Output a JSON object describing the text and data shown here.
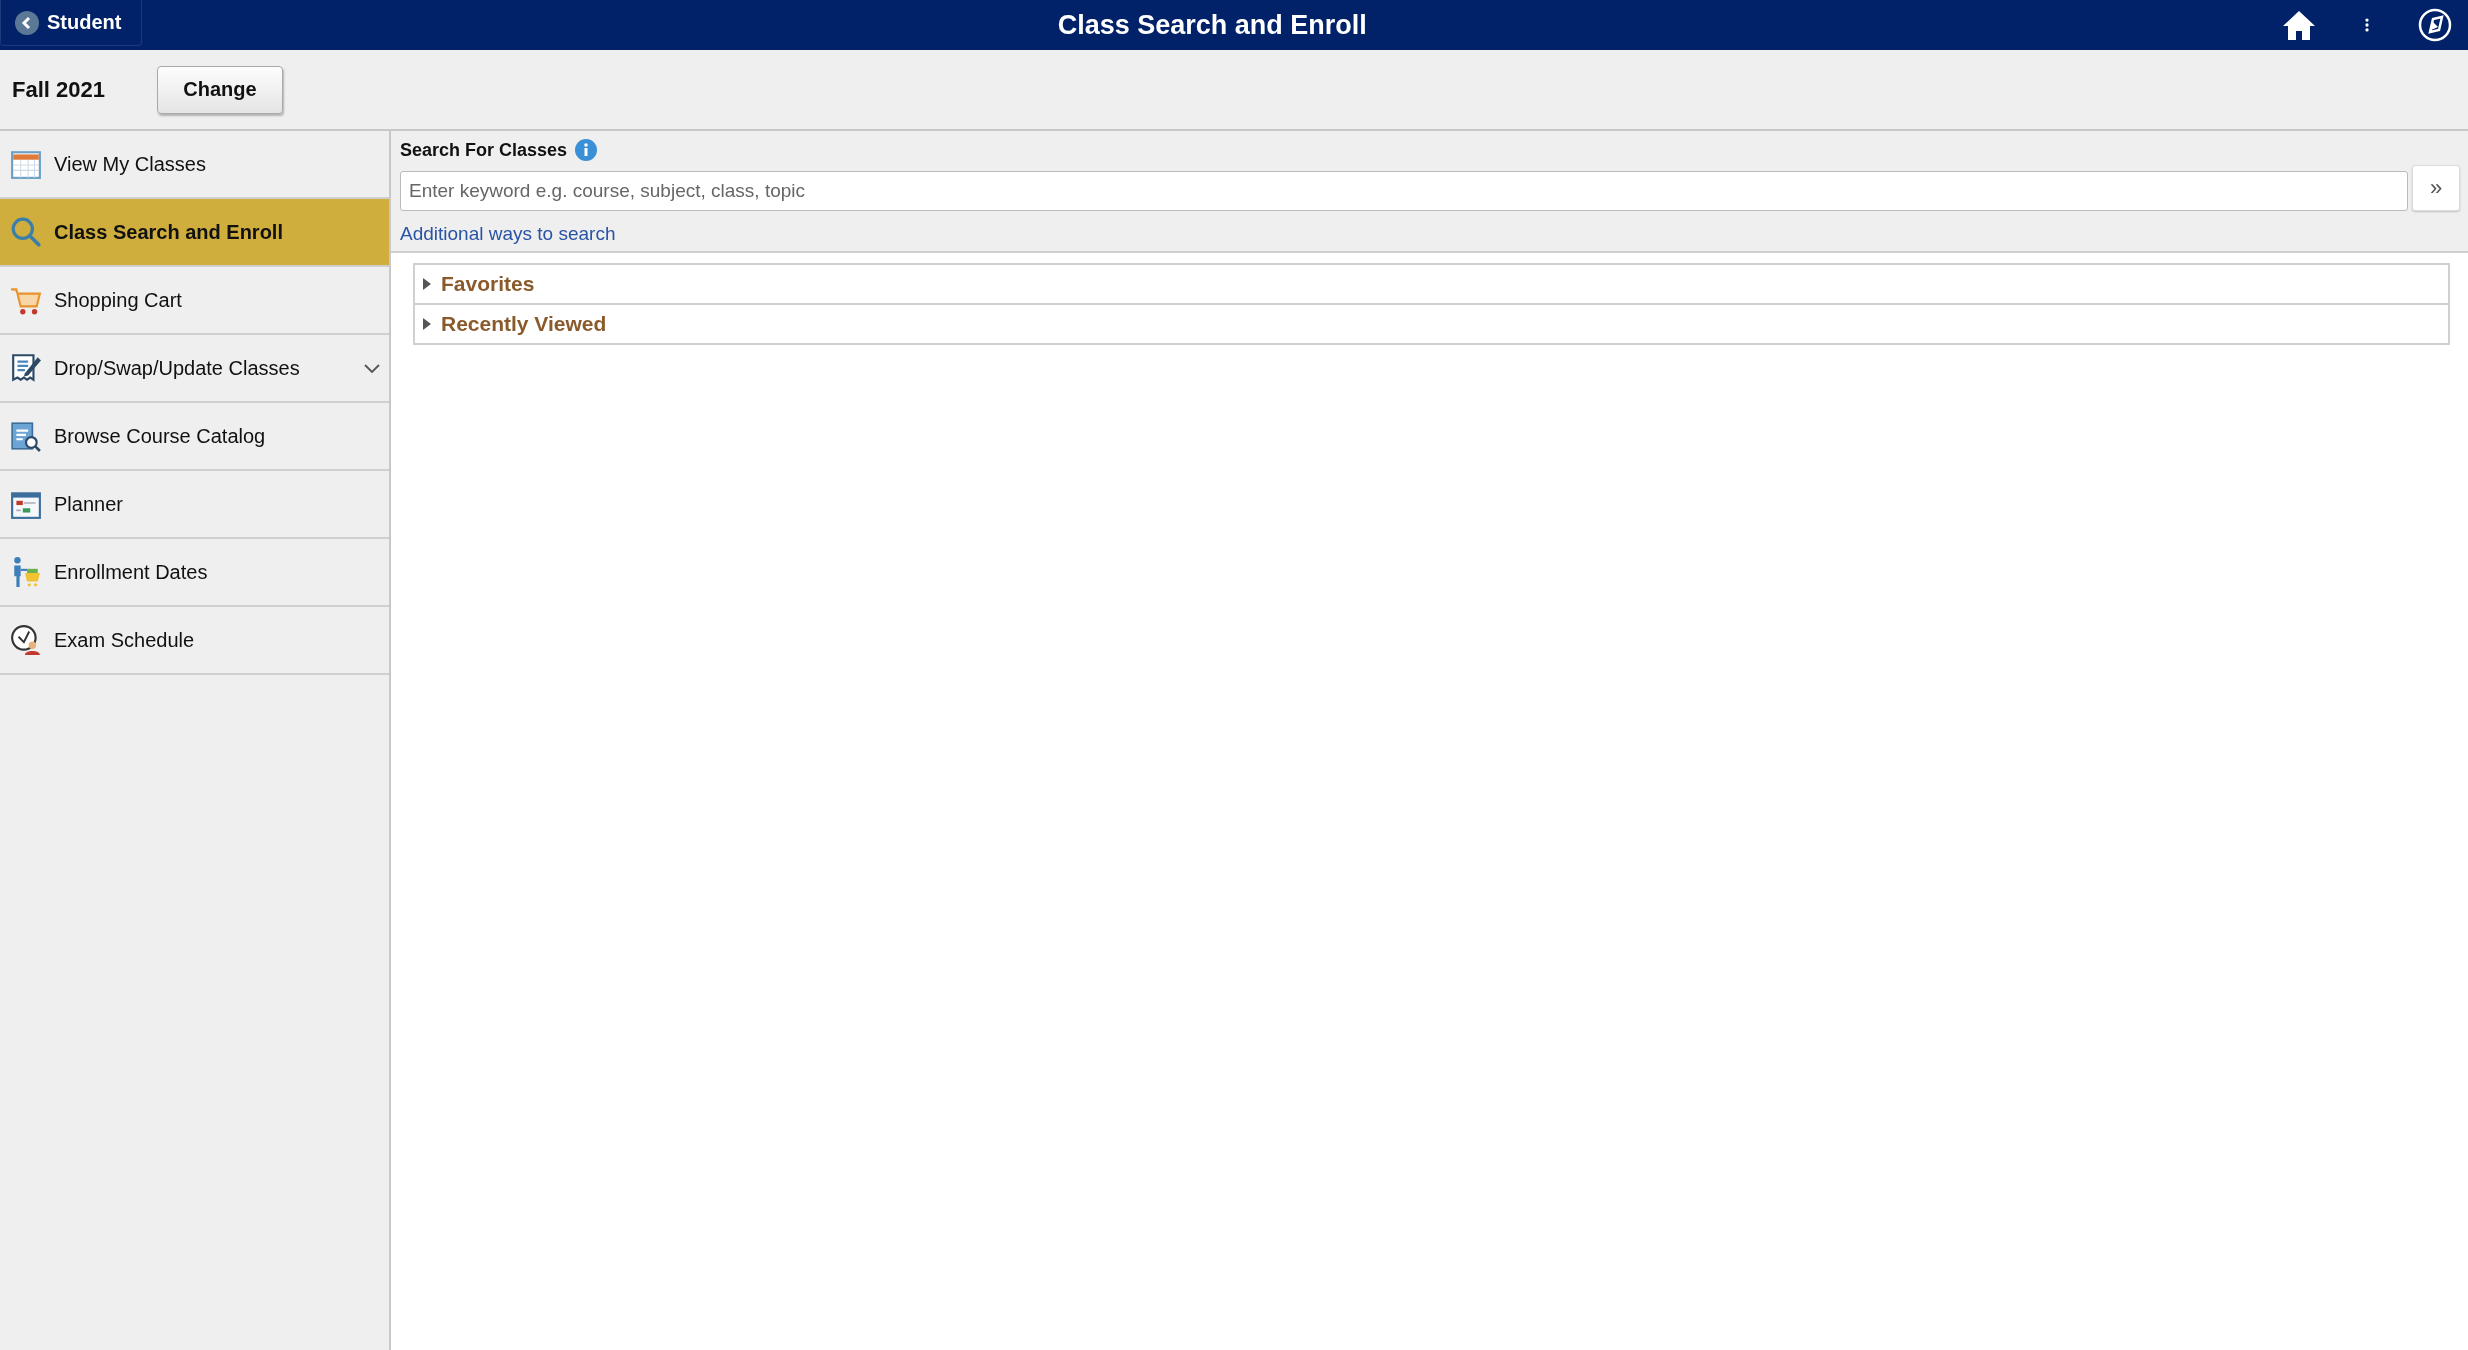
{
  "header": {
    "back_label": "Student",
    "title": "Class Search and Enroll"
  },
  "term": {
    "label": "Fall 2021",
    "button": "Change"
  },
  "sidebar": {
    "items": [
      {
        "label": "View My Classes",
        "selected": false
      },
      {
        "label": "Class Search and Enroll",
        "selected": true
      },
      {
        "label": "Shopping Cart",
        "selected": false
      },
      {
        "label": "Drop/Swap/Update Classes",
        "selected": false,
        "expanded": false
      },
      {
        "label": "Browse Course Catalog",
        "selected": false
      },
      {
        "label": "Planner",
        "selected": false
      },
      {
        "label": "Enrollment Dates",
        "selected": false
      },
      {
        "label": "Exam Schedule",
        "selected": false
      }
    ]
  },
  "search": {
    "heading": "Search For Classes",
    "placeholder": "Enter keyword e.g. course, subject, class, topic",
    "go_button": "»",
    "link": "Additional ways to search"
  },
  "sections": [
    {
      "title": "Favorites",
      "expanded": false
    },
    {
      "title": "Recently Viewed",
      "expanded": false
    }
  ]
}
